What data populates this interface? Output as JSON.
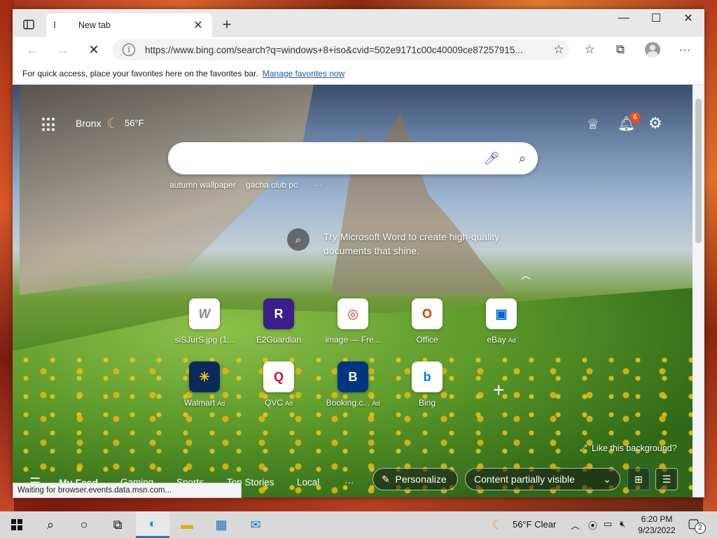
{
  "browser": {
    "tab_title": "New tab",
    "url": "https://www.bing.com/search?q=windows+8+iso&cvid=502e9171c00c40009ce87257915...",
    "favbar_text": "For quick access, place your favorites here on the favorites bar.",
    "favbar_link": "Manage favorites now",
    "status": "Waiting for browser.events.data.msn.com..."
  },
  "ntp": {
    "weather_location": "Bronx",
    "weather_temp": "56°F",
    "notification_count": "6",
    "search_placeholder": "",
    "suggestions": [
      "autumn wallpaper",
      "gacha club pc",
      "···"
    ],
    "promo": "Try Microsoft Word to create high-quality documents that shine.",
    "tiles": [
      {
        "label": "siSJurS.jpg (1...",
        "icon": "W",
        "ad": "",
        "color": "#8a8a8a"
      },
      {
        "label": "E2Guardian",
        "icon": "R",
        "ad": "",
        "color": "#3a1f8a"
      },
      {
        "label": "image — Fre...",
        "icon": "◎",
        "ad": "",
        "color": "#e07a7a"
      },
      {
        "label": "Office",
        "icon": "O",
        "ad": "",
        "color": "#d83b01"
      },
      {
        "label": "eBay",
        "icon": "▣",
        "ad": "Ad",
        "color": "#0064d2"
      },
      {
        "label": "Walmart",
        "icon": "✳",
        "ad": "Ad",
        "color": "#0071ce"
      },
      {
        "label": "QVC",
        "icon": "Q",
        "ad": "Ad",
        "color": "#c8102e"
      },
      {
        "label": "Booking.c...",
        "icon": "B",
        "ad": "Ad",
        "color": "#003580"
      },
      {
        "label": "Bing",
        "icon": "b",
        "ad": "",
        "color": "#0078d4"
      }
    ],
    "like_background": "Like this background?",
    "feed": {
      "tabs": [
        "My Feed",
        "Gaming",
        "Sports",
        "Top Stories",
        "Local"
      ],
      "more": "···",
      "personalize": "Personalize",
      "content_visibility": "Content partially visible"
    }
  },
  "taskbar": {
    "weather": "56°F  Clear",
    "time": "6:20 PM",
    "date": "9/23/2022",
    "notification_count": "2"
  }
}
